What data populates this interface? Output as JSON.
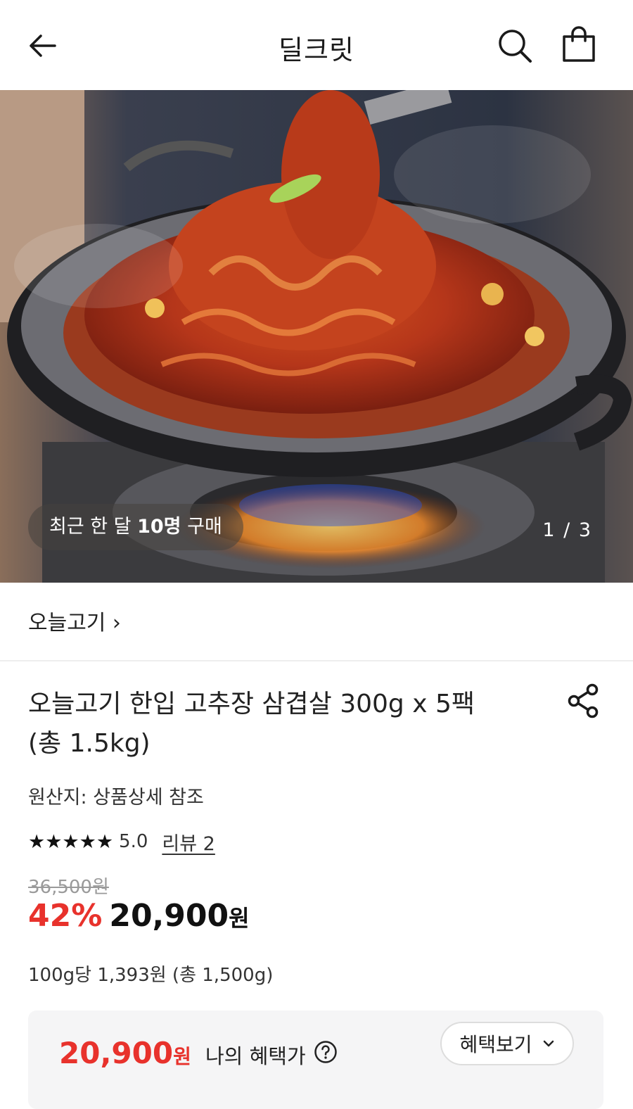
{
  "header": {
    "title": "딜크릿",
    "icons": [
      "back-arrow-icon",
      "search-icon",
      "shopping-bag-icon"
    ]
  },
  "hero": {
    "buyers_prefix": "최근 한 달 ",
    "buyers_count": "10명",
    "buyers_suffix": " 구매",
    "pager": "1 / 3",
    "image_position": 1,
    "image_total": 3
  },
  "product": {
    "brand": "오늘고기 ›",
    "title_line1": "오늘고기 한입 고추장 삼겹살 300g x 5팩",
    "title_line2": "(총 1.5kg)",
    "origin": "원산지: 상품상세 참조",
    "stars": "★★★★★",
    "rating": "5.0",
    "review": "리뷰 2",
    "original_price": "36,500원",
    "discount": "42%",
    "price": "20,900",
    "price_unit": "원",
    "unit_price": "100g당 1,393원 (총 1,500g)"
  },
  "benefit": {
    "price": "20,900",
    "price_unit": "원",
    "label": "나의 혜택가",
    "button": "혜택보기"
  },
  "colors": {
    "accent": "#e8322c",
    "text": "#222222",
    "muted": "#9a9a9a",
    "box": "#f5f5f6"
  }
}
